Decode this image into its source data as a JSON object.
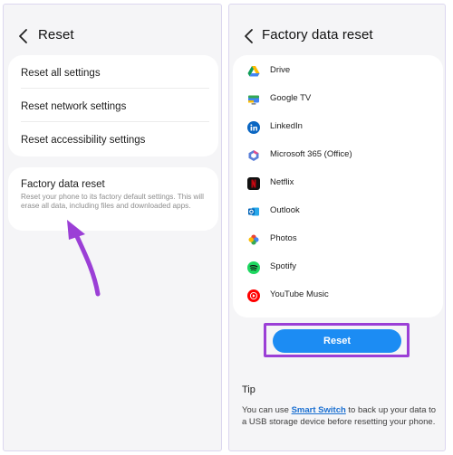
{
  "left": {
    "title": "Reset",
    "items": [
      {
        "label": "Reset all settings"
      },
      {
        "label": "Reset network settings"
      },
      {
        "label": "Reset accessibility settings"
      }
    ],
    "factory": {
      "title": "Factory data reset",
      "description": "Reset your phone to its factory default settings. This will erase all data, including files and downloaded apps."
    }
  },
  "right": {
    "title": "Factory data reset",
    "apps": [
      {
        "label": "Drive",
        "icon": "google-drive-icon"
      },
      {
        "label": "Google TV",
        "icon": "google-tv-icon"
      },
      {
        "label": "LinkedIn",
        "icon": "linkedin-icon"
      },
      {
        "label": "Microsoft 365 (Office)",
        "icon": "microsoft-365-icon"
      },
      {
        "label": "Netflix",
        "icon": "netflix-icon"
      },
      {
        "label": "Outlook",
        "icon": "outlook-icon"
      },
      {
        "label": "Photos",
        "icon": "google-photos-icon"
      },
      {
        "label": "Spotify",
        "icon": "spotify-icon"
      },
      {
        "label": "YouTube Music",
        "icon": "youtube-music-icon"
      }
    ],
    "reset_label": "Reset",
    "tip": {
      "title": "Tip",
      "text_before": "You can use ",
      "link": "Smart Switch",
      "text_after": " to back up your data to a USB storage device before resetting your phone."
    }
  },
  "colors": {
    "accent": "#1c8cf3",
    "highlight": "#9b3fd6",
    "link": "#1a6fd1"
  }
}
